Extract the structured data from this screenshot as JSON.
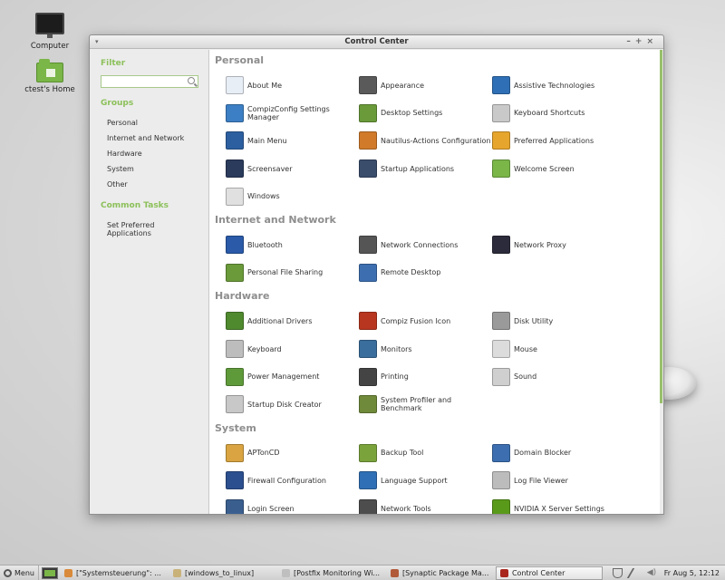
{
  "desktop": {
    "icons": [
      {
        "label": "Computer"
      },
      {
        "label": "ctest's Home"
      }
    ]
  },
  "window": {
    "title": "Control Center",
    "controls": {
      "minimize": "–",
      "maximize": "+",
      "close": "×"
    }
  },
  "sidebar": {
    "filter_heading": "Filter",
    "filter_value": "",
    "groups_heading": "Groups",
    "groups": [
      "Personal",
      "Internet and Network",
      "Hardware",
      "System",
      "Other"
    ],
    "tasks_heading": "Common Tasks",
    "tasks": [
      "Set Preferred Applications"
    ]
  },
  "sections": [
    {
      "title": "Personal",
      "items": [
        {
          "label": "About Me",
          "icon": "about-me-icon",
          "color": "#e8eef6"
        },
        {
          "label": "Appearance",
          "icon": "appearance-icon",
          "color": "#5a5a5a"
        },
        {
          "label": "Assistive Technologies",
          "icon": "assistive-icon",
          "color": "#2f6fb5"
        },
        {
          "label": "CompizConfig Settings Manager",
          "icon": "compiz-config-icon",
          "color": "#3d7fc4"
        },
        {
          "label": "Desktop Settings",
          "icon": "desktop-settings-icon",
          "color": "#6a9a3a"
        },
        {
          "label": "Keyboard Shortcuts",
          "icon": "keyboard-shortcuts-icon",
          "color": "#c9c9c9"
        },
        {
          "label": "Main Menu",
          "icon": "main-menu-icon",
          "color": "#2c5fa0"
        },
        {
          "label": "Nautilus-Actions Configuration",
          "icon": "nautilus-actions-icon",
          "color": "#d07a2a"
        },
        {
          "label": "Preferred Applications",
          "icon": "preferred-apps-icon",
          "color": "#e6a52d"
        },
        {
          "label": "Screensaver",
          "icon": "screensaver-icon",
          "color": "#2b3b5c"
        },
        {
          "label": "Startup Applications",
          "icon": "startup-apps-icon",
          "color": "#3a4d6b"
        },
        {
          "label": "Welcome Screen",
          "icon": "welcome-screen-icon",
          "color": "#7ab648"
        },
        {
          "label": "Windows",
          "icon": "windows-icon",
          "color": "#e0e0e0"
        }
      ]
    },
    {
      "title": "Internet and Network",
      "items": [
        {
          "label": "Bluetooth",
          "icon": "bluetooth-icon",
          "color": "#2a5aa8"
        },
        {
          "label": "Network Connections",
          "icon": "network-connections-icon",
          "color": "#555555"
        },
        {
          "label": "Network Proxy",
          "icon": "network-proxy-icon",
          "color": "#2b2b3b"
        },
        {
          "label": "Personal File Sharing",
          "icon": "file-sharing-icon",
          "color": "#6a9a3a"
        },
        {
          "label": "Remote Desktop",
          "icon": "remote-desktop-icon",
          "color": "#3d6fb0"
        }
      ]
    },
    {
      "title": "Hardware",
      "items": [
        {
          "label": "Additional Drivers",
          "icon": "additional-drivers-icon",
          "color": "#4f8a2e"
        },
        {
          "label": "Compiz Fusion Icon",
          "icon": "compiz-fusion-icon",
          "color": "#b8361f"
        },
        {
          "label": "Disk Utility",
          "icon": "disk-utility-icon",
          "color": "#9a9a9a"
        },
        {
          "label": "Keyboard",
          "icon": "keyboard-icon",
          "color": "#bdbdbd"
        },
        {
          "label": "Monitors",
          "icon": "monitors-icon",
          "color": "#3a6e9c"
        },
        {
          "label": "Mouse",
          "icon": "mouse-icon",
          "color": "#dcdcdc"
        },
        {
          "label": "Power Management",
          "icon": "power-management-icon",
          "color": "#5f9a3a"
        },
        {
          "label": "Printing",
          "icon": "printing-icon",
          "color": "#444444"
        },
        {
          "label": "Sound",
          "icon": "sound-icon",
          "color": "#cfcfcf"
        },
        {
          "label": "Startup Disk Creator",
          "icon": "startup-disk-icon",
          "color": "#c8c8c8"
        },
        {
          "label": "System Profiler and Benchmark",
          "icon": "system-profiler-icon",
          "color": "#6f8a3a"
        }
      ]
    },
    {
      "title": "System",
      "items": [
        {
          "label": "APTonCD",
          "icon": "aptoncd-icon",
          "color": "#d9a441"
        },
        {
          "label": "Backup Tool",
          "icon": "backup-tool-icon",
          "color": "#7aa33c"
        },
        {
          "label": "Domain Blocker",
          "icon": "domain-blocker-icon",
          "color": "#3d6fb0"
        },
        {
          "label": "Firewall Configuration",
          "icon": "firewall-icon",
          "color": "#2c4f8f"
        },
        {
          "label": "Language Support",
          "icon": "language-support-icon",
          "color": "#2f6fb5"
        },
        {
          "label": "Log File Viewer",
          "icon": "log-viewer-icon",
          "color": "#bcbcbc"
        },
        {
          "label": "Login Screen",
          "icon": "login-screen-icon",
          "color": "#3a5f8f"
        },
        {
          "label": "Network Tools",
          "icon": "network-tools-icon",
          "color": "#4d4d4d"
        },
        {
          "label": "NVIDIA X Server Settings",
          "icon": "nvidia-icon",
          "color": "#5a9a1a"
        }
      ]
    }
  ],
  "taskbar": {
    "menu_label": "Menu",
    "windows": [
      {
        "label": "[\"Systemsteuerung\": ...",
        "color": "#d98a3a",
        "active": false
      },
      {
        "label": "[windows_to_linux]",
        "color": "#c9b27a",
        "active": false
      },
      {
        "label": "[Postfix Monitoring Wi...",
        "color": "#bfbfbf",
        "active": false
      },
      {
        "label": "[Synaptic Package Ma...",
        "color": "#b05a3a",
        "active": false
      },
      {
        "label": "Control Center",
        "color": "#a8281e",
        "active": true
      }
    ],
    "clock": "Fr Aug  5, 12:12"
  }
}
